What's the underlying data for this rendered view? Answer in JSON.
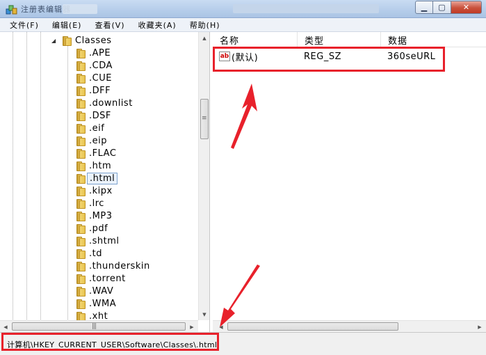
{
  "window": {
    "title": "注册表编辑器"
  },
  "menu": [
    "文件(F)",
    "编辑(E)",
    "查看(V)",
    "收藏夹(A)",
    "帮助(H)"
  ],
  "tree": {
    "parent": "Classes",
    "items": [
      ".APE",
      ".CDA",
      ".CUE",
      ".DFF",
      ".downlist",
      ".DSF",
      ".eif",
      ".eip",
      ".FLAC",
      ".htm",
      ".html",
      ".kipx",
      ".lrc",
      ".MP3",
      ".pdf",
      ".shtml",
      ".td",
      ".thunderskin",
      ".torrent",
      ".WAV",
      ".WMA",
      ".xht"
    ],
    "selected": ".html"
  },
  "list": {
    "columns": [
      "名称",
      "类型",
      "数据"
    ],
    "rows": [
      {
        "name": "(默认)",
        "type": "REG_SZ",
        "data": "360seURL"
      }
    ]
  },
  "status": {
    "path": "计算机\\HKEY_CURRENT_USER\\Software\\Classes\\.html"
  },
  "colors": {
    "highlight": "#e8212b",
    "titlebar": "#b5cdea"
  }
}
